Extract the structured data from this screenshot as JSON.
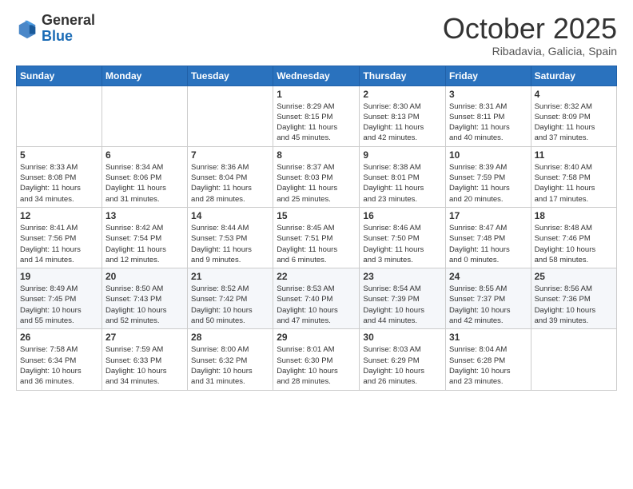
{
  "header": {
    "logo_general": "General",
    "logo_blue": "Blue",
    "month": "October 2025",
    "location": "Ribadavia, Galicia, Spain"
  },
  "days_of_week": [
    "Sunday",
    "Monday",
    "Tuesday",
    "Wednesday",
    "Thursday",
    "Friday",
    "Saturday"
  ],
  "weeks": [
    {
      "days": [
        {
          "num": "",
          "info": ""
        },
        {
          "num": "",
          "info": ""
        },
        {
          "num": "",
          "info": ""
        },
        {
          "num": "1",
          "info": "Sunrise: 8:29 AM\nSunset: 8:15 PM\nDaylight: 11 hours\nand 45 minutes."
        },
        {
          "num": "2",
          "info": "Sunrise: 8:30 AM\nSunset: 8:13 PM\nDaylight: 11 hours\nand 42 minutes."
        },
        {
          "num": "3",
          "info": "Sunrise: 8:31 AM\nSunset: 8:11 PM\nDaylight: 11 hours\nand 40 minutes."
        },
        {
          "num": "4",
          "info": "Sunrise: 8:32 AM\nSunset: 8:09 PM\nDaylight: 11 hours\nand 37 minutes."
        }
      ]
    },
    {
      "days": [
        {
          "num": "5",
          "info": "Sunrise: 8:33 AM\nSunset: 8:08 PM\nDaylight: 11 hours\nand 34 minutes."
        },
        {
          "num": "6",
          "info": "Sunrise: 8:34 AM\nSunset: 8:06 PM\nDaylight: 11 hours\nand 31 minutes."
        },
        {
          "num": "7",
          "info": "Sunrise: 8:36 AM\nSunset: 8:04 PM\nDaylight: 11 hours\nand 28 minutes."
        },
        {
          "num": "8",
          "info": "Sunrise: 8:37 AM\nSunset: 8:03 PM\nDaylight: 11 hours\nand 25 minutes."
        },
        {
          "num": "9",
          "info": "Sunrise: 8:38 AM\nSunset: 8:01 PM\nDaylight: 11 hours\nand 23 minutes."
        },
        {
          "num": "10",
          "info": "Sunrise: 8:39 AM\nSunset: 7:59 PM\nDaylight: 11 hours\nand 20 minutes."
        },
        {
          "num": "11",
          "info": "Sunrise: 8:40 AM\nSunset: 7:58 PM\nDaylight: 11 hours\nand 17 minutes."
        }
      ]
    },
    {
      "days": [
        {
          "num": "12",
          "info": "Sunrise: 8:41 AM\nSunset: 7:56 PM\nDaylight: 11 hours\nand 14 minutes."
        },
        {
          "num": "13",
          "info": "Sunrise: 8:42 AM\nSunset: 7:54 PM\nDaylight: 11 hours\nand 12 minutes."
        },
        {
          "num": "14",
          "info": "Sunrise: 8:44 AM\nSunset: 7:53 PM\nDaylight: 11 hours\nand 9 minutes."
        },
        {
          "num": "15",
          "info": "Sunrise: 8:45 AM\nSunset: 7:51 PM\nDaylight: 11 hours\nand 6 minutes."
        },
        {
          "num": "16",
          "info": "Sunrise: 8:46 AM\nSunset: 7:50 PM\nDaylight: 11 hours\nand 3 minutes."
        },
        {
          "num": "17",
          "info": "Sunrise: 8:47 AM\nSunset: 7:48 PM\nDaylight: 11 hours\nand 0 minutes."
        },
        {
          "num": "18",
          "info": "Sunrise: 8:48 AM\nSunset: 7:46 PM\nDaylight: 10 hours\nand 58 minutes."
        }
      ]
    },
    {
      "days": [
        {
          "num": "19",
          "info": "Sunrise: 8:49 AM\nSunset: 7:45 PM\nDaylight: 10 hours\nand 55 minutes."
        },
        {
          "num": "20",
          "info": "Sunrise: 8:50 AM\nSunset: 7:43 PM\nDaylight: 10 hours\nand 52 minutes."
        },
        {
          "num": "21",
          "info": "Sunrise: 8:52 AM\nSunset: 7:42 PM\nDaylight: 10 hours\nand 50 minutes."
        },
        {
          "num": "22",
          "info": "Sunrise: 8:53 AM\nSunset: 7:40 PM\nDaylight: 10 hours\nand 47 minutes."
        },
        {
          "num": "23",
          "info": "Sunrise: 8:54 AM\nSunset: 7:39 PM\nDaylight: 10 hours\nand 44 minutes."
        },
        {
          "num": "24",
          "info": "Sunrise: 8:55 AM\nSunset: 7:37 PM\nDaylight: 10 hours\nand 42 minutes."
        },
        {
          "num": "25",
          "info": "Sunrise: 8:56 AM\nSunset: 7:36 PM\nDaylight: 10 hours\nand 39 minutes."
        }
      ]
    },
    {
      "days": [
        {
          "num": "26",
          "info": "Sunrise: 7:58 AM\nSunset: 6:34 PM\nDaylight: 10 hours\nand 36 minutes."
        },
        {
          "num": "27",
          "info": "Sunrise: 7:59 AM\nSunset: 6:33 PM\nDaylight: 10 hours\nand 34 minutes."
        },
        {
          "num": "28",
          "info": "Sunrise: 8:00 AM\nSunset: 6:32 PM\nDaylight: 10 hours\nand 31 minutes."
        },
        {
          "num": "29",
          "info": "Sunrise: 8:01 AM\nSunset: 6:30 PM\nDaylight: 10 hours\nand 28 minutes."
        },
        {
          "num": "30",
          "info": "Sunrise: 8:03 AM\nSunset: 6:29 PM\nDaylight: 10 hours\nand 26 minutes."
        },
        {
          "num": "31",
          "info": "Sunrise: 8:04 AM\nSunset: 6:28 PM\nDaylight: 10 hours\nand 23 minutes."
        },
        {
          "num": "",
          "info": ""
        }
      ]
    }
  ]
}
